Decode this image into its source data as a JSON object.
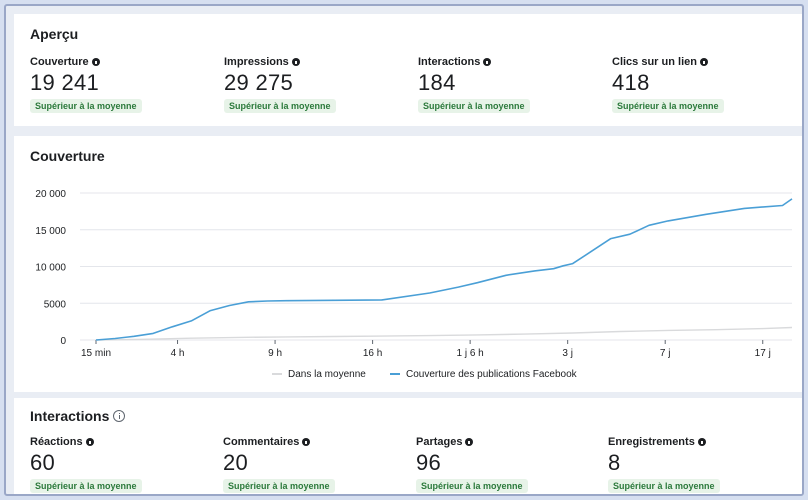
{
  "apercu": {
    "title": "Aperçu",
    "metrics": [
      {
        "label": "Couverture",
        "value": "19 241",
        "badge": "Supérieur à la moyenne"
      },
      {
        "label": "Impressions",
        "value": "29 275",
        "badge": "Supérieur à la moyenne"
      },
      {
        "label": "Interactions",
        "value": "184",
        "badge": "Supérieur à la moyenne"
      },
      {
        "label": "Clics sur un lien",
        "value": "418",
        "badge": "Supérieur à la moyenne"
      }
    ]
  },
  "couverture": {
    "title": "Couverture"
  },
  "interactions": {
    "title": "Interactions",
    "metrics": [
      {
        "label": "Réactions",
        "value": "60",
        "badge": "Supérieur à la moyenne"
      },
      {
        "label": "Commentaires",
        "value": "20",
        "badge": "Supérieur à la moyenne"
      },
      {
        "label": "Partages",
        "value": "96",
        "badge": "Supérieur à la moyenne"
      },
      {
        "label": "Enregistrements",
        "value": "8",
        "badge": "Supérieur à la moyenne"
      }
    ]
  },
  "chart_data": {
    "type": "line",
    "title": "Couverture",
    "x_ticks": [
      "15 min",
      "4 h",
      "9 h",
      "16 h",
      "1 j 6 h",
      "3 j",
      "7 j",
      "17 j"
    ],
    "y_ticks": [
      "0",
      "5000",
      "10 000",
      "15 000",
      "20 000"
    ],
    "ylim": [
      0,
      20000
    ],
    "legend_position": "bottom",
    "grid": true,
    "series": [
      {
        "name": "Dans la moyenne",
        "color": "#d9dadc",
        "x": [
          0,
          0.5,
          1,
          1.5,
          2,
          2.5,
          3,
          3.5,
          4,
          4.5,
          5,
          5.5,
          6,
          6.5,
          7,
          7.3
        ],
        "values": [
          0,
          100,
          250,
          350,
          420,
          480,
          530,
          600,
          700,
          800,
          950,
          1150,
          1300,
          1400,
          1550,
          1700
        ]
      },
      {
        "name": "Couverture des publications Facebook",
        "color": "#4a9fd6",
        "x": [
          0,
          0.2,
          0.4,
          0.6,
          0.8,
          1,
          1.2,
          1.4,
          1.6,
          1.8,
          2,
          2.5,
          3,
          3.5,
          3.8,
          4,
          4.3,
          4.6,
          4.8,
          4.9,
          5,
          5.2,
          5.4,
          5.6,
          5.8,
          6,
          6.4,
          6.8,
          7.2,
          7.3
        ],
        "values": [
          0,
          200,
          500,
          900,
          1800,
          2600,
          4000,
          4700,
          5200,
          5300,
          5350,
          5400,
          5450,
          6400,
          7200,
          7800,
          8800,
          9400,
          9700,
          10100,
          10400,
          12100,
          13800,
          14400,
          15600,
          16200,
          17100,
          17900,
          18300,
          19200
        ]
      }
    ]
  }
}
